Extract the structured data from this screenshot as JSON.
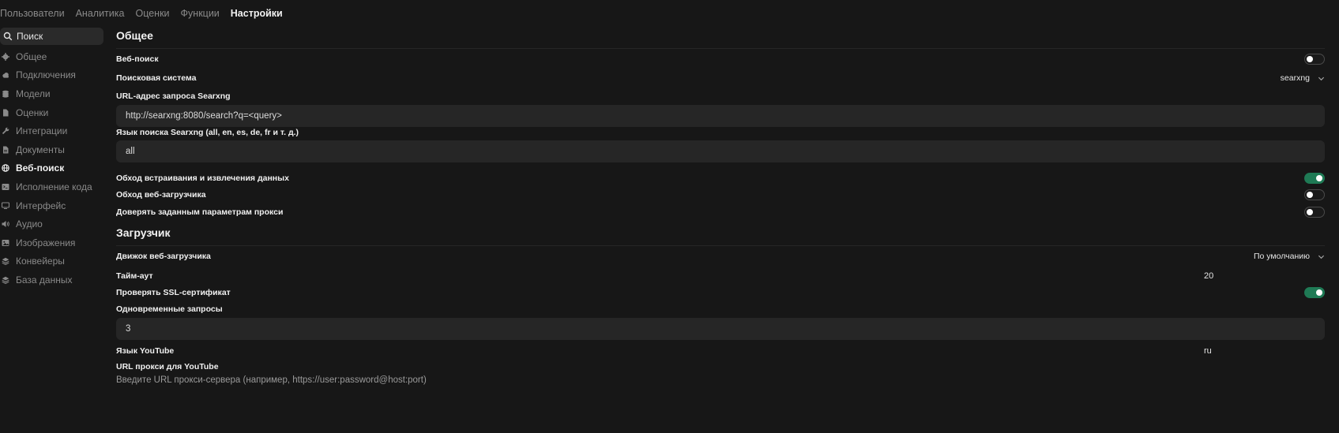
{
  "tabs": [
    {
      "label": "Пользователи"
    },
    {
      "label": "Аналитика"
    },
    {
      "label": "Оценки"
    },
    {
      "label": "Функции"
    },
    {
      "label": "Настройки"
    }
  ],
  "sidebar": {
    "search_label": "Поиск",
    "items": [
      {
        "label": "Общее",
        "icon": "gear-icon"
      },
      {
        "label": "Подключения",
        "icon": "cloud-icon"
      },
      {
        "label": "Модели",
        "icon": "cube-stack-icon"
      },
      {
        "label": "Оценки",
        "icon": "document-icon"
      },
      {
        "label": "Интеграции",
        "icon": "wrench-icon"
      },
      {
        "label": "Документы",
        "icon": "document-text-icon"
      },
      {
        "label": "Веб-поиск",
        "icon": "globe-icon"
      },
      {
        "label": "Исполнение кода",
        "icon": "terminal-icon"
      },
      {
        "label": "Интерфейс",
        "icon": "monitor-icon"
      },
      {
        "label": "Аудио",
        "icon": "speaker-icon"
      },
      {
        "label": "Изображения",
        "icon": "image-icon"
      },
      {
        "label": "Конвейеры",
        "icon": "layers-icon"
      },
      {
        "label": "База данных",
        "icon": "database-icon"
      }
    ]
  },
  "general": {
    "title": "Общее",
    "web_search_label": "Веб-поиск",
    "web_search_enabled": false,
    "engine_label": "Поисковая система",
    "engine_value": "searxng",
    "searxng_url_label": "URL-адрес запроса Searxng",
    "searxng_url_value": "http://searxng:8080/search?q=<query>",
    "searxng_lang_label": "Язык поиска Searxng (all, en, es, de, fr и т. д.)",
    "searxng_lang_value": "all",
    "bypass_embed_label": "Обход встраивания и извлечения данных",
    "bypass_embed_enabled": true,
    "bypass_loader_label": "Обход веб-загрузчика",
    "bypass_loader_enabled": false,
    "trust_proxy_label": "Доверять заданным параметрам прокси",
    "trust_proxy_enabled": false
  },
  "loader": {
    "title": "Загрузчик",
    "engine_label": "Движок веб-загрузчика",
    "engine_value": "По умолчанию",
    "timeout_label": "Тайм-аут",
    "timeout_value": "20",
    "ssl_label": "Проверять SSL-сертификат",
    "ssl_enabled": true,
    "concurrent_label": "Одновременные запросы",
    "concurrent_value": "3",
    "youtube_lang_label": "Язык YouTube",
    "youtube_lang_value": "ru",
    "youtube_proxy_label": "URL прокси для YouTube",
    "youtube_proxy_placeholder": "Введите URL прокси-сервера (например, https://user:password@host:port)"
  },
  "colors": {
    "background": "#171717",
    "toggle_on": "#1f7a55"
  }
}
